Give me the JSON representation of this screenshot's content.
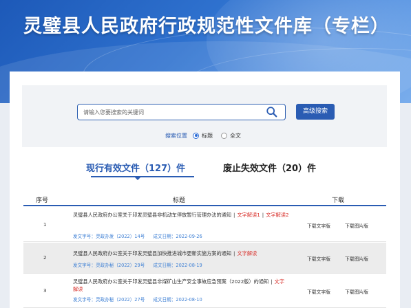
{
  "header": {
    "title": "灵璧县人民政府行政规范性文件库（专栏）"
  },
  "search": {
    "placeholder": "请输入您要搜索的关键词",
    "advanced_label": "高级搜索",
    "scope_label": "搜索位置",
    "scope_options": [
      "标题",
      "全文"
    ],
    "scope_selected": "标题"
  },
  "tabs": [
    {
      "label": "现行有效文件（127）件",
      "active": true
    },
    {
      "label": "废止失效文件（20）件",
      "active": false
    }
  ],
  "table": {
    "columns": [
      "序号",
      "标题",
      "下载"
    ],
    "rows": [
      {
        "no": "1",
        "title": "灵璧县人民政府办公室关于印发灵璧县非机动车停放暂行管理办法的通知",
        "tag1": "文字解读1",
        "tag2": "文字解读2",
        "doc_no": "发文字号：灵政办发（2022）14号",
        "date": "成文日期：2022-09-26",
        "dl_text": "下载文字版",
        "dl_img": "下载图片版"
      },
      {
        "no": "2",
        "title": "灵璧县人民政府办公室关于印发灵璧县加快推进城市更新实施方案的通知",
        "tag1": "文字解读",
        "doc_no": "发文字号：灵政办秘（2022）29号",
        "date": "成文日期：2022-08-19",
        "dl_text": "下载文字版",
        "dl_img": "下载图片版"
      },
      {
        "no": "3",
        "title": "灵璧县人民政府办公室关于印发灵璧县非煤矿山生产安全事故应急预案（2022版）的通知",
        "tag1": "文字解读",
        "doc_no": "发文字号：灵政办秘（2022）27号",
        "date": "成文日期：2022-08-10",
        "dl_text": "下载文字版",
        "dl_img": "下载图片版"
      }
    ]
  },
  "colors": {
    "accent": "#2a5cb3",
    "tag_red": "#d8302b",
    "meta_blue": "#3d7fd4"
  }
}
